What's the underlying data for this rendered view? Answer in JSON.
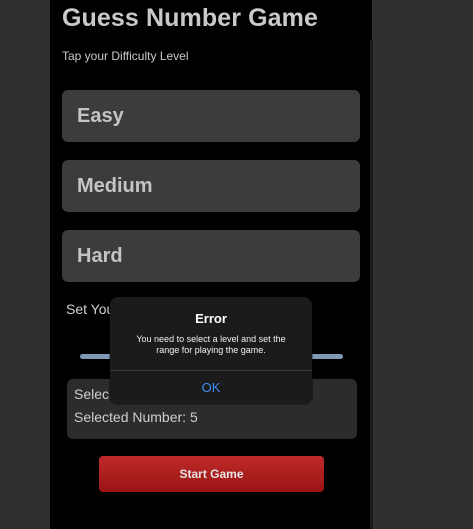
{
  "app": {
    "title": "Guess Number Game",
    "subtitle": "Tap your Difficulty Level"
  },
  "levels": [
    {
      "label": "Easy"
    },
    {
      "label": "Medium"
    },
    {
      "label": "Hard"
    }
  ],
  "range": {
    "label_visible": "Set You"
  },
  "info": {
    "level_line_visible": "Selec",
    "number_line": "Selected Number: 5"
  },
  "start_button": {
    "label": "Start Game"
  },
  "dialog": {
    "title": "Error",
    "message": "You need to select a level and set the range for playing the game.",
    "ok_label": "OK"
  },
  "colors": {
    "page_background": "#303030",
    "app_background": "#000000",
    "button_background": "#3c3c3c",
    "accent_red": "#b01e1e",
    "dialog_link_blue": "#3e8ef7",
    "slider_track": "#7f98b3"
  }
}
